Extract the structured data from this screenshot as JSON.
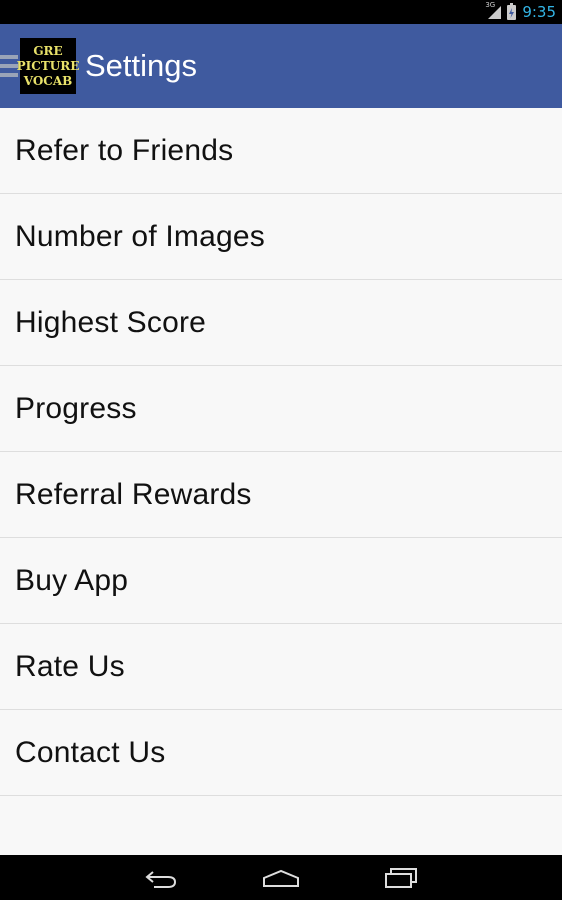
{
  "status_bar": {
    "network": "3G",
    "time": "9:35",
    "clock_color": "#33b5e5"
  },
  "action_bar": {
    "logo_lines": [
      "GRE",
      "PICTURE",
      "VOCAB"
    ],
    "title": "Settings",
    "background": "#3f5a9f"
  },
  "settings": {
    "items": [
      {
        "label": "Refer to Friends"
      },
      {
        "label": "Number of Images"
      },
      {
        "label": "Highest Score"
      },
      {
        "label": "Progress"
      },
      {
        "label": "Referral Rewards"
      },
      {
        "label": "Buy App"
      },
      {
        "label": "Rate Us"
      },
      {
        "label": "Contact Us"
      }
    ]
  },
  "nav_bar": {
    "buttons": [
      "back-icon",
      "home-icon",
      "recent-apps-icon"
    ]
  }
}
